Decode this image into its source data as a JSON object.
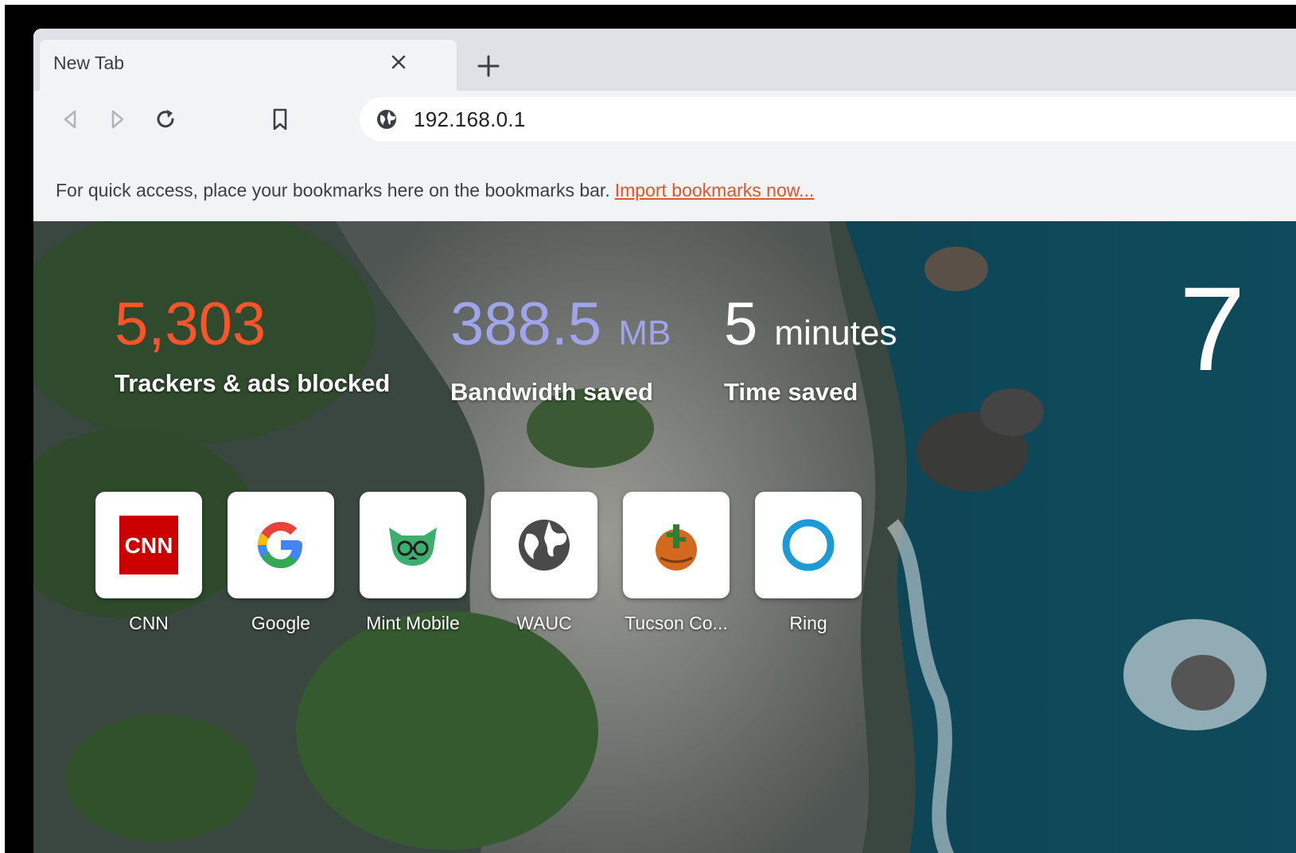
{
  "tab": {
    "title": "New Tab"
  },
  "omnibox": {
    "url": "192.168.0.1"
  },
  "bookmarks_bar": {
    "hint": "For quick access, place your bookmarks here on the bookmarks bar.",
    "import_link": "Import bookmarks now..."
  },
  "stats": {
    "trackers": {
      "value": "5,303",
      "label": "Trackers & ads blocked",
      "color": "#fb542b"
    },
    "bandwidth": {
      "value": "388.5",
      "unit": "MB",
      "label": "Bandwidth saved",
      "color": "#a0a5eb"
    },
    "time": {
      "value": "5",
      "unit": "minutes",
      "label": "Time saved",
      "color": "#ffffff"
    }
  },
  "clock": {
    "text": "7"
  },
  "top_sites": [
    {
      "label": "CNN",
      "icon": "cnn-icon"
    },
    {
      "label": "Google",
      "icon": "google-icon"
    },
    {
      "label": "Mint Mobile",
      "icon": "mint-mobile-icon"
    },
    {
      "label": "WAUC",
      "icon": "globe-icon"
    },
    {
      "label": "Tucson Co...",
      "icon": "tucson-icon"
    },
    {
      "label": "Ring",
      "icon": "ring-icon"
    }
  ],
  "icons": {
    "back": "back-arrow-icon",
    "forward": "forward-arrow-icon",
    "reload": "reload-icon",
    "bookmark": "bookmark-icon",
    "site_info": "globe-icon",
    "close_tab": "close-icon",
    "new_tab": "plus-icon"
  }
}
